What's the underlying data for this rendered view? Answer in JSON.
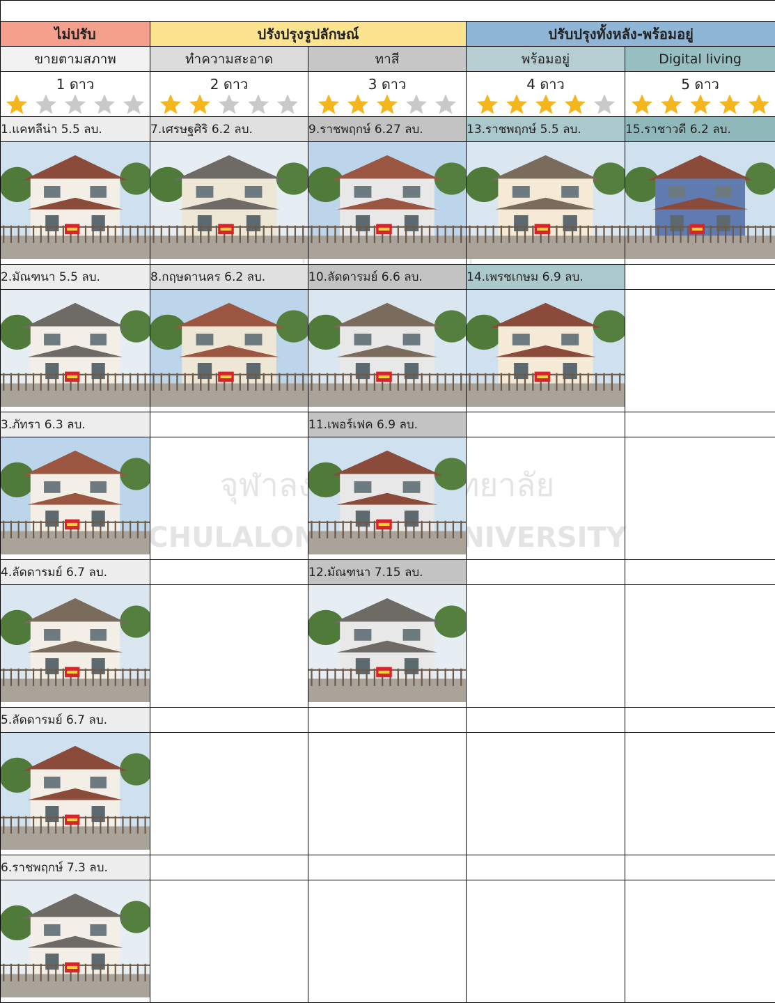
{
  "groups": [
    {
      "label": "ไม่ปรับ",
      "color": "#f4a08c"
    },
    {
      "label": "ปรังปรุงรูปลักษณ์",
      "color": "#fce38f"
    },
    {
      "label": "ปรับปรุงทั้งหลัง-พร้อมอยู่",
      "color": "#90b6d7"
    }
  ],
  "columns": [
    {
      "label": "ขายตามสภาพ",
      "rating": "1 ดาว",
      "stars": 1,
      "bg": "#f2f2f2",
      "cell_bg": "#ededed"
    },
    {
      "label": "ทำความสะอาด",
      "rating": "2 ดาว",
      "stars": 2,
      "bg": "#dcdcdc",
      "cell_bg": "#e0e0e0"
    },
    {
      "label": "ทาสี",
      "rating": "3 ดาว",
      "stars": 3,
      "bg": "#c6c6c6",
      "cell_bg": "#c3c3c3"
    },
    {
      "label": "พร้อมอยู่",
      "rating": "4 ดาว",
      "stars": 4,
      "bg": "#b6cdd2",
      "cell_bg": "#abc8cd"
    },
    {
      "label": "Digital living",
      "rating": "5 ดาว",
      "stars": 5,
      "bg": "#97bfc2",
      "cell_bg": "#8fb8bb"
    }
  ],
  "rows": [
    [
      "1.แคทลีน่า 5.5 ลบ.",
      "7.เศรษฐศิริ 6.2 ลบ.",
      "9.ราชพฤกษ์ 6.27 ลบ.",
      "13.ราชพฤกษ์ 5.5 ลบ.",
      "15.ราชาวดี 6.2 ลบ."
    ],
    [
      "2.มัณฑนา 5.5 ลบ.",
      "8.กฤษดานคร 6.2 ลบ.",
      "10.ลัดดารมย์ 6.6 ลบ.",
      "14.เพรชเกษม 6.9 ลบ.",
      ""
    ],
    [
      "3.ภัทรา 6.3 ลบ.",
      "",
      "11.เพอร์เฟค 6.9 ลบ.",
      "",
      ""
    ],
    [
      "4.ลัดดารมย์ 6.7 ลบ.",
      "",
      "12.มัณฑนา 7.15 ลบ.",
      "",
      ""
    ],
    [
      "5.ลัดดารมย์ 6.7 ลบ.",
      "",
      "",
      "",
      ""
    ],
    [
      "6.ราชพฤกษ์ 7.3 ลบ.",
      "",
      "",
      "",
      ""
    ]
  ],
  "watermark": {
    "thai": "จุฬาลงกรณ์มหาวิทยาลัย",
    "latin": "CHULALONGKORN UNIVERSITY"
  },
  "star_colors": {
    "on": "#f5b51c",
    "off": "#c9c9c9"
  }
}
